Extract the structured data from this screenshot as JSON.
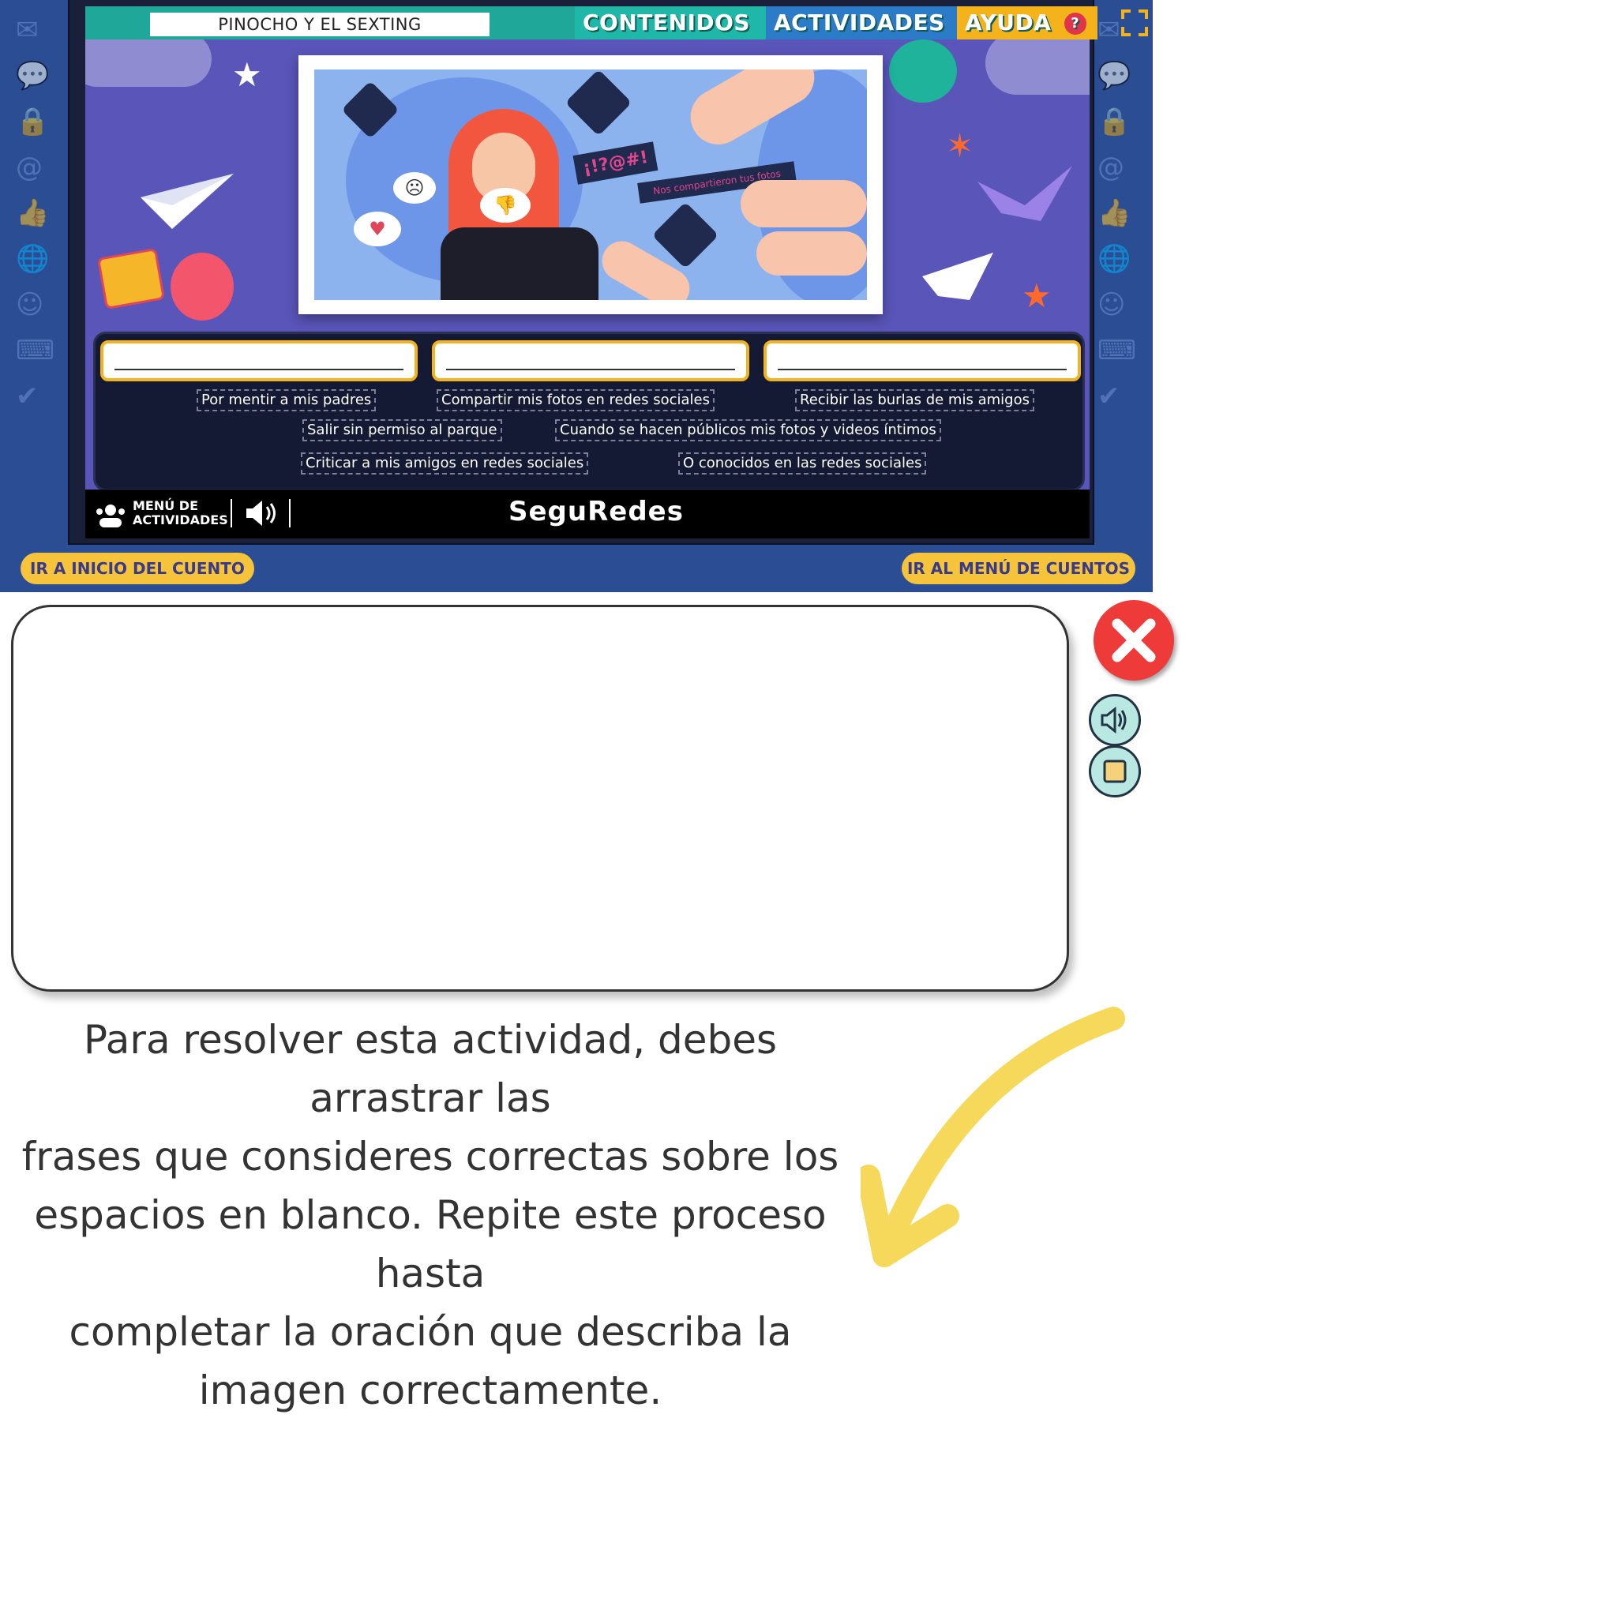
{
  "header": {
    "title": "PINOCHO Y EL SEXTING",
    "nav": {
      "contenidos": "CONTENIDOS",
      "actividades": "ACTIVIDADES",
      "ayuda": "AYUDA"
    }
  },
  "picture": {
    "speech_label": "Nos compartieron tus fotos",
    "symbol_text": "¡!?@#!"
  },
  "drop_slots": [
    "",
    "",
    ""
  ],
  "chips": [
    "Por mentir a mis padres",
    "Compartir mis fotos en redes sociales",
    "Recibir las burlas de mis amigos",
    "Salir sin permiso al parque",
    "Cuando se hacen públicos mis fotos y videos íntimos",
    "Criticar a mis amigos en redes sociales",
    "O conocidos en las redes sociales"
  ],
  "bottombar": {
    "menu_line1": "MENÚ DE",
    "menu_line2": "ACTIVIDADES",
    "brand": "SeguRedes"
  },
  "footer_buttons": {
    "left": "IR A INICIO DEL CUENTO",
    "right": "IR AL MENÚ DE CUENTOS"
  },
  "instruction_lines": [
    "Para resolver esta actividad, debes arrastrar las",
    "frases  que consideres correctas sobre los",
    "espacios en blanco. Repite este proceso hasta",
    "completar la oración que describa la",
    "imagen correctamente."
  ],
  "colors": {
    "frame_blue": "#2a4d93",
    "play_purple": "#5a55b9",
    "header_teal": "#1fa79a",
    "accent_yellow": "#f6c43a",
    "close_red": "#ef3a3a",
    "arrow_yellow": "#f6d95a"
  },
  "icons": {
    "fullscreen": "fullscreen-icon",
    "close": "close-icon",
    "audio": "speaker-icon",
    "stop": "stop-icon",
    "menu": "group-icon"
  }
}
